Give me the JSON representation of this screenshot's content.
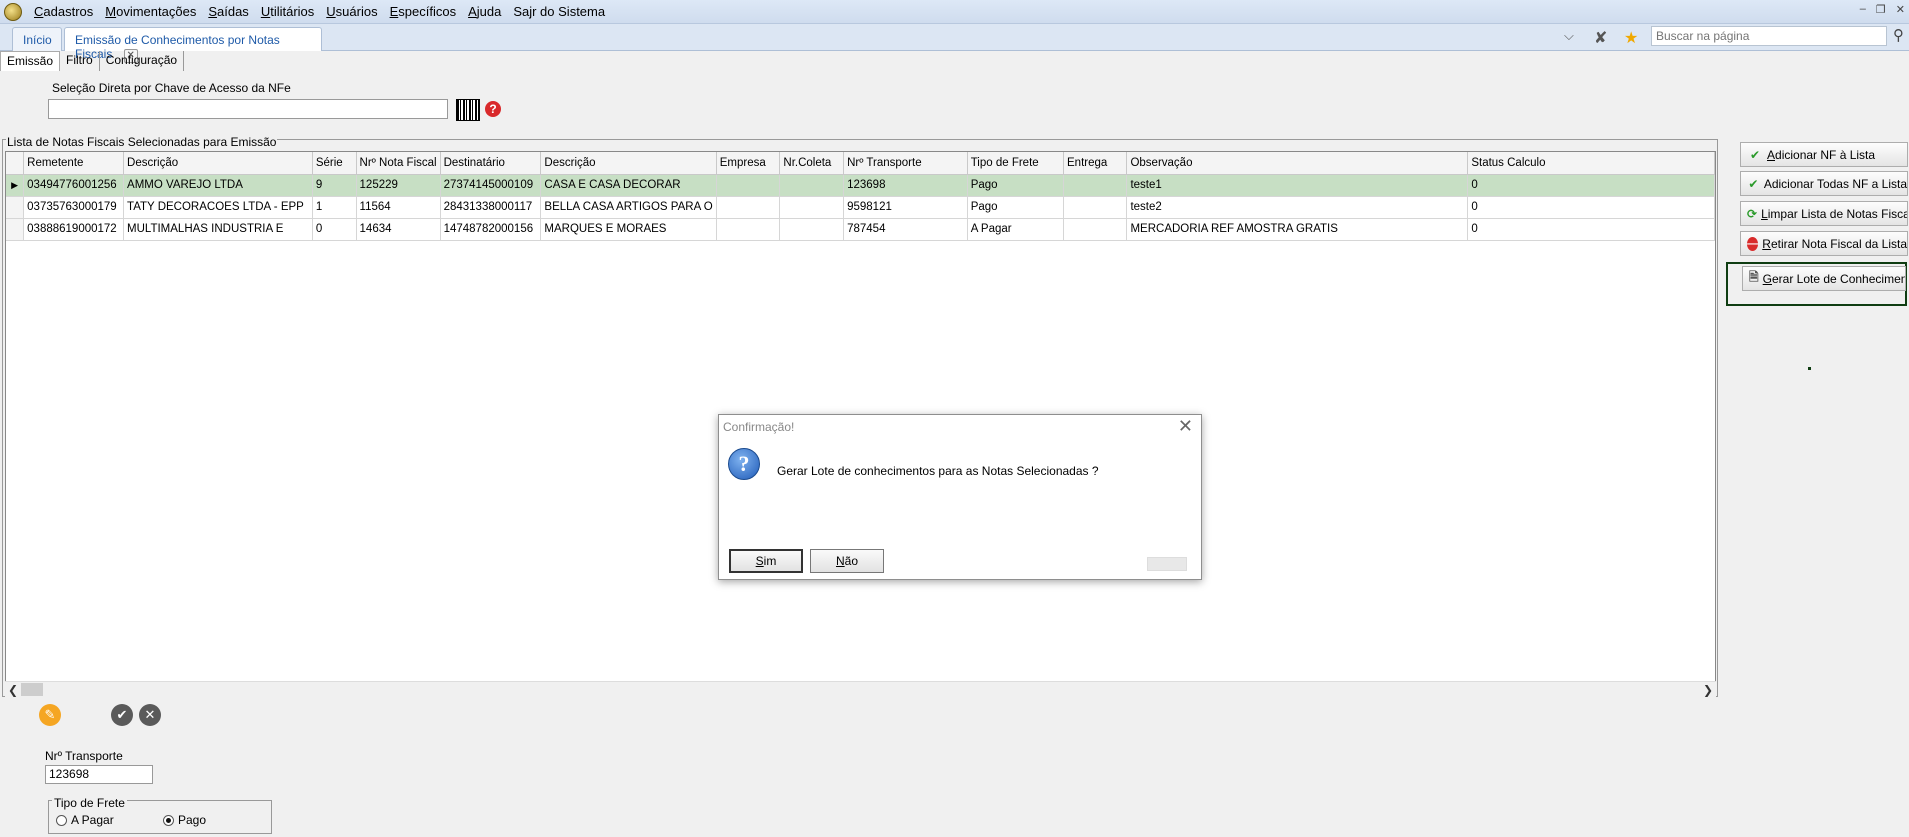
{
  "menu": [
    {
      "u": "C",
      "rest": "adastros"
    },
    {
      "u": "M",
      "rest": "ovimentações"
    },
    {
      "u": "S",
      "rest": "aídas"
    },
    {
      "u": "U",
      "rest": "tilitários"
    },
    {
      "u": "U",
      "rest": "suários"
    },
    {
      "u": "E",
      "rest": "specíficos"
    },
    {
      "u": "A",
      "rest": "juda"
    },
    {
      "u": "",
      "rest": "Sajr do Sistema"
    }
  ],
  "tabs": {
    "home": "Início",
    "active": "Emissão de Conhecimentos por Notas Fiscais"
  },
  "search": {
    "placeholder": "Buscar na página"
  },
  "subtabs": [
    "Emissão",
    "Filtro",
    "Configuração"
  ],
  "nfe": {
    "label": "Seleção Direta por Chave de Acesso da NFe",
    "value": ""
  },
  "grid": {
    "title": "Lista de Notas Fiscais Selecionadas para Emissão",
    "columns": [
      "Remetente",
      "Descrição",
      "Série",
      "Nrº Nota Fiscal",
      "Destinatário",
      "Descrição",
      "Empresa",
      "Nr.Coleta",
      "Nrº Transporte",
      "Tipo de Frete",
      "Entrega",
      "Observação",
      "Status Calculo"
    ],
    "rows": [
      [
        "03494776001256",
        "AMMO VAREJO LTDA",
        "9",
        "125229",
        "27374145000109",
        "CASA E CASA DECORAR",
        "",
        "",
        "123698",
        "Pago",
        "",
        "teste1",
        "0"
      ],
      [
        "03735763000179",
        "TATY DECORACOES LTDA - EPP",
        "1",
        "11564",
        "28431338000117",
        "BELLA CASA ARTIGOS PARA O",
        "",
        "",
        "9598121",
        "Pago",
        "",
        "teste2",
        "0"
      ],
      [
        "03888619000172",
        "MULTIMALHAS INDUSTRIA E",
        "0",
        "14634",
        "14748782000156",
        "MARQUES E MORAES",
        "",
        "",
        "787454",
        "A Pagar",
        "",
        "MERCADORIA REF AMOSTRA GRATIS",
        "0"
      ]
    ],
    "selected_row": 0
  },
  "actions": {
    "add_nf": {
      "u": "A",
      "rest": "dicionar NF à Lista"
    },
    "add_all": {
      "u": "",
      "rest": "Adicionar Todas NF a Lista"
    },
    "clear": {
      "u": "L",
      "rest": "impar Lista de Notas Fiscais"
    },
    "remove": {
      "u": "R",
      "rest": "etirar Nota Fiscal da Lista"
    },
    "generate": {
      "u": "G",
      "rest": "erar Lote de Conhecimento"
    }
  },
  "form": {
    "transport_label": "Nrº Transporte",
    "transport_value": "123698",
    "freight_title": "Tipo de Frete",
    "freight_options": [
      "A Pagar",
      "Pago"
    ],
    "freight_selected": "Pago"
  },
  "dialog": {
    "title": "Confirmação!",
    "message": "Gerar Lote de conhecimentos para as Notas Selecionadas ?",
    "yes": {
      "u": "S",
      "rest": "im"
    },
    "no": {
      "u": "N",
      "rest": "ão"
    }
  },
  "colors": {
    "selected_row": "#c7dfc4",
    "highlight_frame": "#0f3d12",
    "edit_button": "#f5a623",
    "neutral_button": "#5a5a5a"
  }
}
